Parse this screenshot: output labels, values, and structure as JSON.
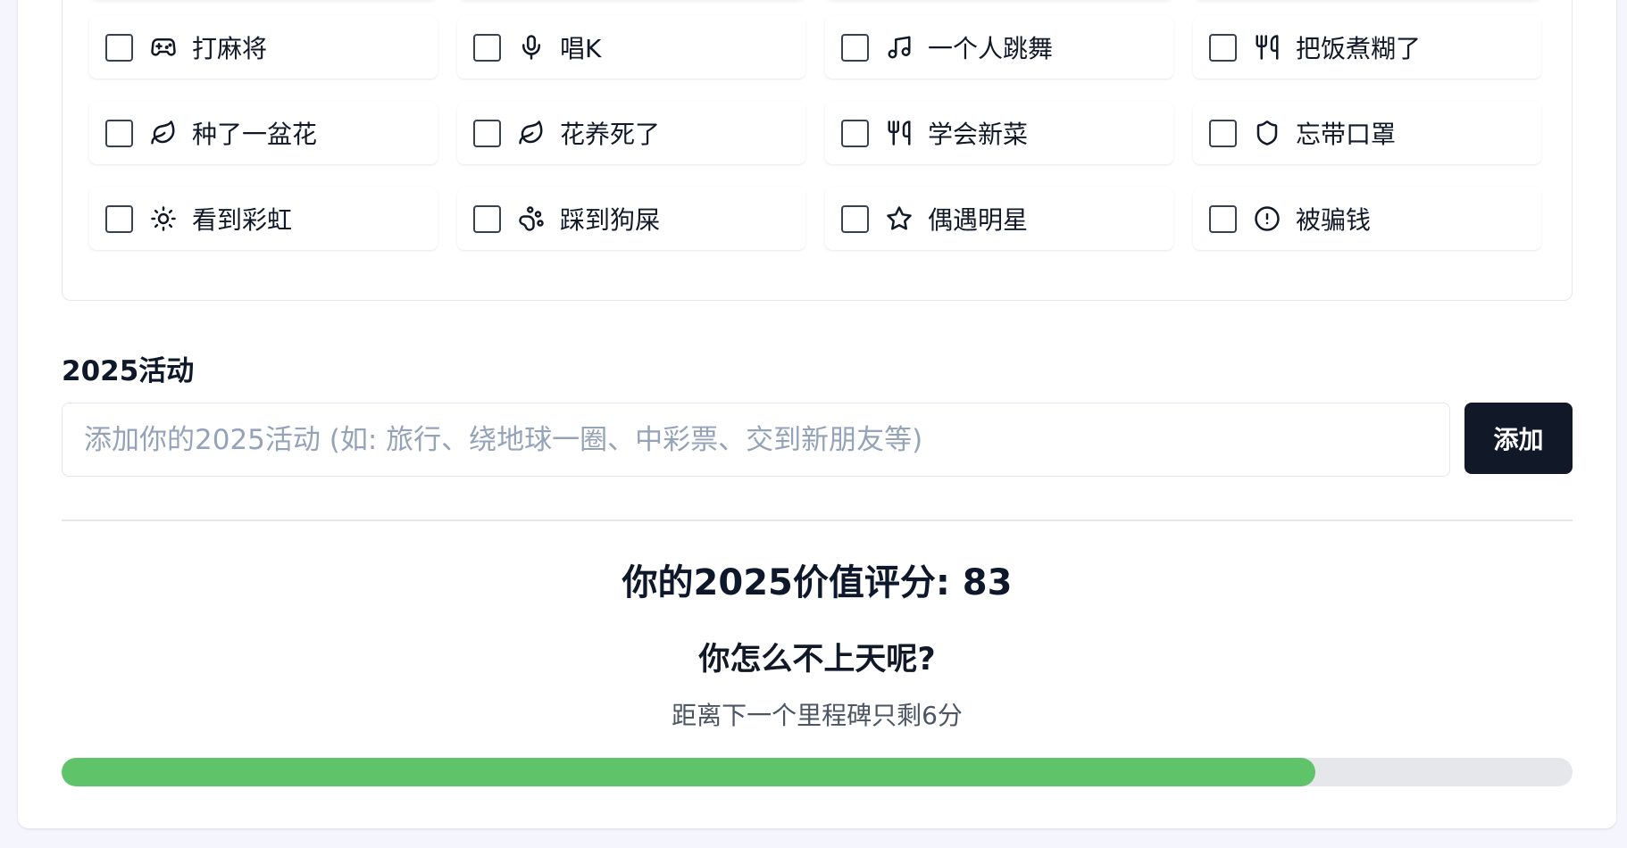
{
  "activities": [
    {
      "label": "打麻将",
      "icon": "gamepad-icon",
      "checked": false
    },
    {
      "label": "唱K",
      "icon": "microphone-icon",
      "checked": false
    },
    {
      "label": "一个人跳舞",
      "icon": "music-icon",
      "checked": false
    },
    {
      "label": "把饭煮糊了",
      "icon": "utensils-icon",
      "checked": false
    },
    {
      "label": "种了一盆花",
      "icon": "leaf-icon",
      "checked": false
    },
    {
      "label": "花养死了",
      "icon": "leaf-icon",
      "checked": false
    },
    {
      "label": "学会新菜",
      "icon": "utensils-icon",
      "checked": false
    },
    {
      "label": "忘带口罩",
      "icon": "shield-icon",
      "checked": false
    },
    {
      "label": "看到彩虹",
      "icon": "sun-icon",
      "checked": false
    },
    {
      "label": "踩到狗屎",
      "icon": "paw-icon",
      "checked": false
    },
    {
      "label": "偶遇明星",
      "icon": "star-icon",
      "checked": false
    },
    {
      "label": "被骗钱",
      "icon": "alert-circle-icon",
      "checked": false
    }
  ],
  "custom": {
    "title": "2025活动",
    "placeholder": "添加你的2025活动 (如: 旅行、绕地球一圈、中彩票、交到新朋友等)",
    "value": "",
    "add_label": "添加"
  },
  "result": {
    "score_text": "你的2025价值评分: 83",
    "verdict": "你怎么不上天呢?",
    "hint": "距离下一个里程碑只剩6分",
    "progress_fraction": 0.83
  },
  "colors": {
    "progress": "#5fc36a",
    "button": "#111827"
  }
}
